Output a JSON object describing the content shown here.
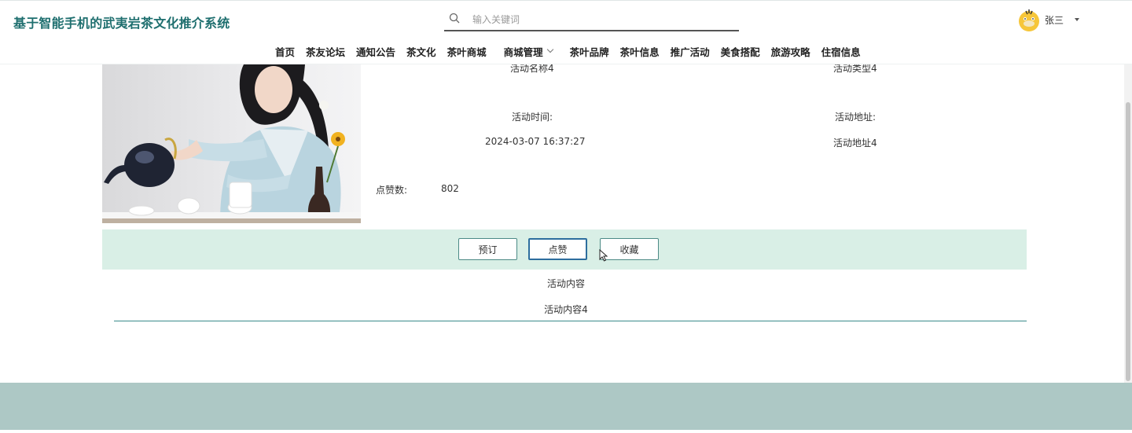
{
  "header": {
    "site_title": "基于智能手机的武夷岩茶文化推介系统",
    "search_placeholder": "输入关键词",
    "user_name": "张三"
  },
  "nav": {
    "items": [
      "首页",
      "茶友论坛",
      "通知公告",
      "茶文化",
      "茶叶商城",
      "商城管理",
      "茶叶品牌",
      "茶叶信息",
      "推广活动",
      "美食搭配",
      "旅游攻略",
      "住宿信息"
    ]
  },
  "detail": {
    "name_value": "活动名称4",
    "type_value": "活动类型4",
    "time_label": "活动时间:",
    "time_value": "2024-03-07 16:37:27",
    "address_label": "活动地址:",
    "address_value": "活动地址4",
    "likes_label": "点赞数:",
    "likes_value": "802"
  },
  "actions": {
    "book": "预订",
    "like": "点赞",
    "favorite": "收藏"
  },
  "content": {
    "title": "活动内容",
    "text": "活动内容4"
  },
  "colors": {
    "title": "#1f6f6f",
    "action_bar": "#d9efe6",
    "footer": "#adc8c5",
    "accent": "#3a8a8a"
  }
}
